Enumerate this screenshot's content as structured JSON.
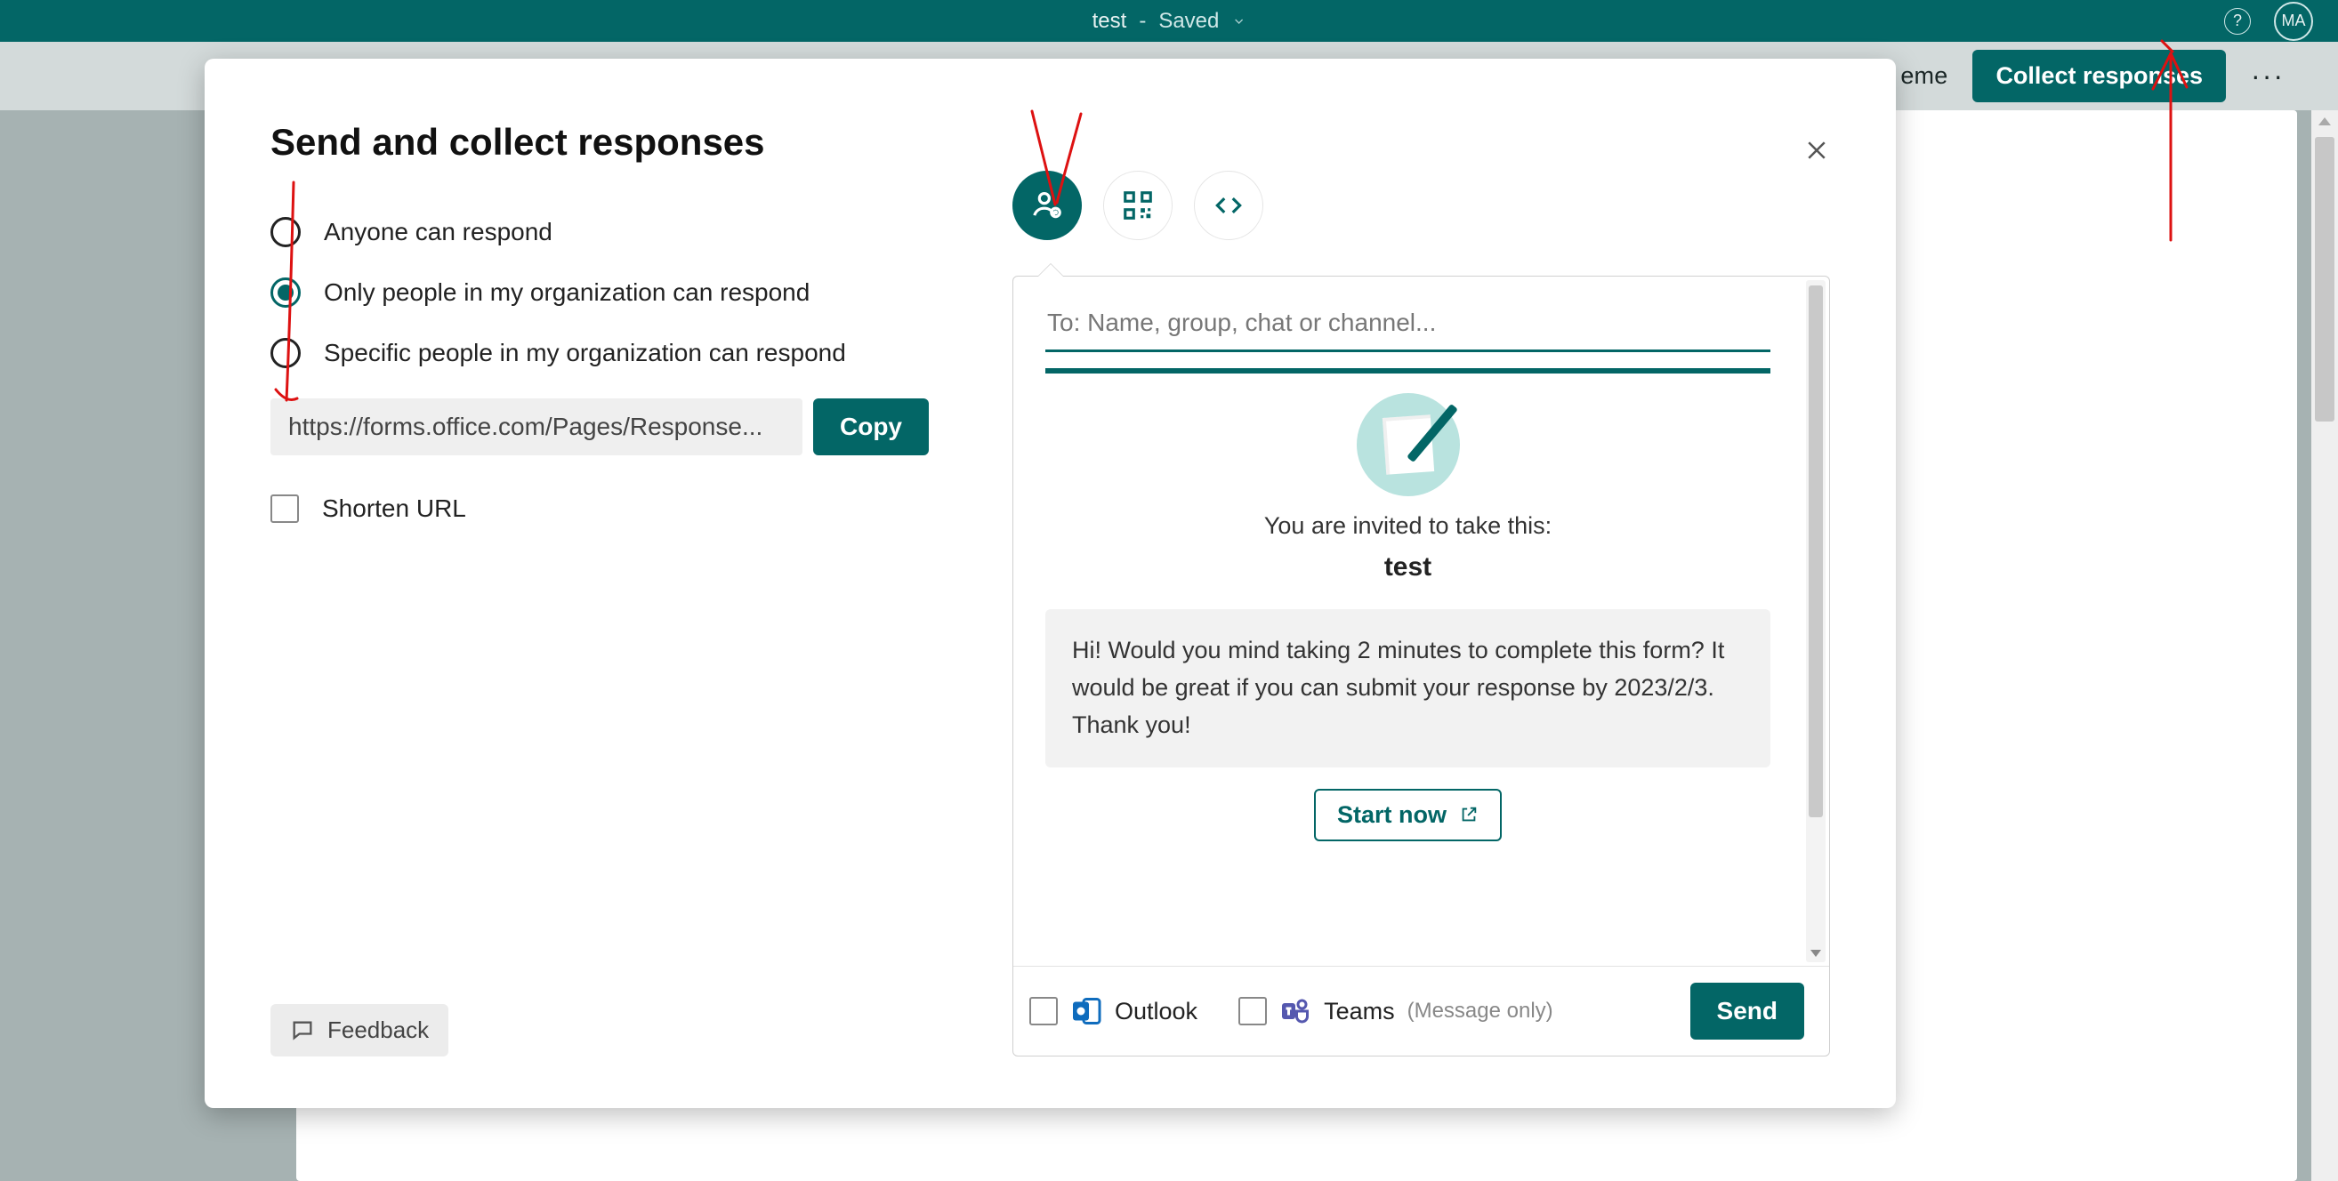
{
  "appbar": {
    "title": "test",
    "dash": "-",
    "saved": "Saved",
    "avatar": "MA",
    "help": "?"
  },
  "toolbar": {
    "theme": "eme",
    "collect": "Collect responses",
    "more": "···"
  },
  "dialog": {
    "title": "Send and collect responses",
    "radios": {
      "anyone": "Anyone can respond",
      "org": "Only people in my organization can respond",
      "specific": "Specific people in my organization can respond"
    },
    "url": "https://forms.office.com/Pages/Response...",
    "copy": "Copy",
    "shorten": "Shorten URL",
    "feedback": "Feedback",
    "tabs": {
      "invite": "invite-icon",
      "qr": "qr-icon",
      "embed": "embed-icon"
    },
    "panel": {
      "to_placeholder": "To: Name, group, chat or channel...",
      "invited_line": "You are invited to take this:",
      "form_name": "test",
      "message": "Hi! Would you mind taking 2 minutes to complete this form? It would be great if you can submit your response by 2023/2/3. Thank you!",
      "start": "Start now",
      "outlook": "Outlook",
      "teams": "Teams",
      "teams_note": "(Message only)",
      "send": "Send"
    }
  }
}
